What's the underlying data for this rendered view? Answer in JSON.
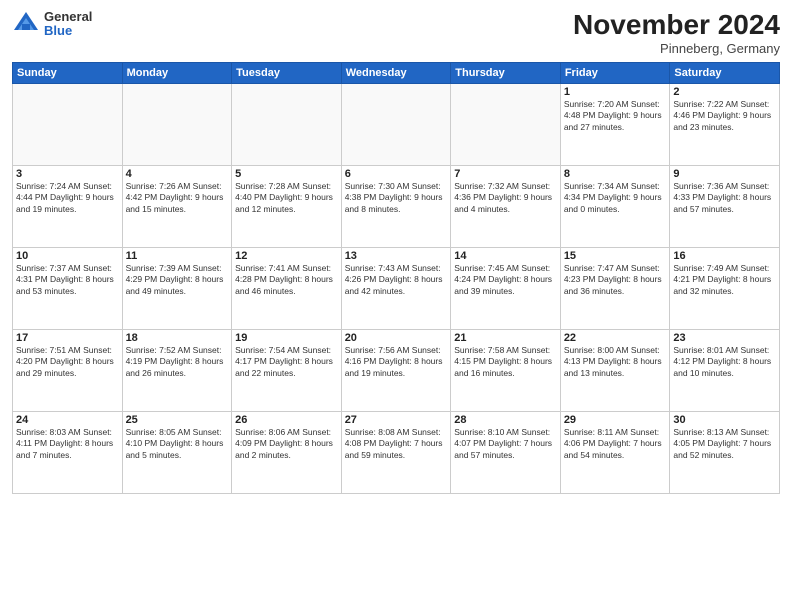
{
  "header": {
    "logo_general": "General",
    "logo_blue": "Blue",
    "month_title": "November 2024",
    "subtitle": "Pinneberg, Germany"
  },
  "days_of_week": [
    "Sunday",
    "Monday",
    "Tuesday",
    "Wednesday",
    "Thursday",
    "Friday",
    "Saturday"
  ],
  "weeks": [
    [
      {
        "day": "",
        "info": ""
      },
      {
        "day": "",
        "info": ""
      },
      {
        "day": "",
        "info": ""
      },
      {
        "day": "",
        "info": ""
      },
      {
        "day": "",
        "info": ""
      },
      {
        "day": "1",
        "info": "Sunrise: 7:20 AM\nSunset: 4:48 PM\nDaylight: 9 hours\nand 27 minutes."
      },
      {
        "day": "2",
        "info": "Sunrise: 7:22 AM\nSunset: 4:46 PM\nDaylight: 9 hours\nand 23 minutes."
      }
    ],
    [
      {
        "day": "3",
        "info": "Sunrise: 7:24 AM\nSunset: 4:44 PM\nDaylight: 9 hours\nand 19 minutes."
      },
      {
        "day": "4",
        "info": "Sunrise: 7:26 AM\nSunset: 4:42 PM\nDaylight: 9 hours\nand 15 minutes."
      },
      {
        "day": "5",
        "info": "Sunrise: 7:28 AM\nSunset: 4:40 PM\nDaylight: 9 hours\nand 12 minutes."
      },
      {
        "day": "6",
        "info": "Sunrise: 7:30 AM\nSunset: 4:38 PM\nDaylight: 9 hours\nand 8 minutes."
      },
      {
        "day": "7",
        "info": "Sunrise: 7:32 AM\nSunset: 4:36 PM\nDaylight: 9 hours\nand 4 minutes."
      },
      {
        "day": "8",
        "info": "Sunrise: 7:34 AM\nSunset: 4:34 PM\nDaylight: 9 hours\nand 0 minutes."
      },
      {
        "day": "9",
        "info": "Sunrise: 7:36 AM\nSunset: 4:33 PM\nDaylight: 8 hours\nand 57 minutes."
      }
    ],
    [
      {
        "day": "10",
        "info": "Sunrise: 7:37 AM\nSunset: 4:31 PM\nDaylight: 8 hours\nand 53 minutes."
      },
      {
        "day": "11",
        "info": "Sunrise: 7:39 AM\nSunset: 4:29 PM\nDaylight: 8 hours\nand 49 minutes."
      },
      {
        "day": "12",
        "info": "Sunrise: 7:41 AM\nSunset: 4:28 PM\nDaylight: 8 hours\nand 46 minutes."
      },
      {
        "day": "13",
        "info": "Sunrise: 7:43 AM\nSunset: 4:26 PM\nDaylight: 8 hours\nand 42 minutes."
      },
      {
        "day": "14",
        "info": "Sunrise: 7:45 AM\nSunset: 4:24 PM\nDaylight: 8 hours\nand 39 minutes."
      },
      {
        "day": "15",
        "info": "Sunrise: 7:47 AM\nSunset: 4:23 PM\nDaylight: 8 hours\nand 36 minutes."
      },
      {
        "day": "16",
        "info": "Sunrise: 7:49 AM\nSunset: 4:21 PM\nDaylight: 8 hours\nand 32 minutes."
      }
    ],
    [
      {
        "day": "17",
        "info": "Sunrise: 7:51 AM\nSunset: 4:20 PM\nDaylight: 8 hours\nand 29 minutes."
      },
      {
        "day": "18",
        "info": "Sunrise: 7:52 AM\nSunset: 4:19 PM\nDaylight: 8 hours\nand 26 minutes."
      },
      {
        "day": "19",
        "info": "Sunrise: 7:54 AM\nSunset: 4:17 PM\nDaylight: 8 hours\nand 22 minutes."
      },
      {
        "day": "20",
        "info": "Sunrise: 7:56 AM\nSunset: 4:16 PM\nDaylight: 8 hours\nand 19 minutes."
      },
      {
        "day": "21",
        "info": "Sunrise: 7:58 AM\nSunset: 4:15 PM\nDaylight: 8 hours\nand 16 minutes."
      },
      {
        "day": "22",
        "info": "Sunrise: 8:00 AM\nSunset: 4:13 PM\nDaylight: 8 hours\nand 13 minutes."
      },
      {
        "day": "23",
        "info": "Sunrise: 8:01 AM\nSunset: 4:12 PM\nDaylight: 8 hours\nand 10 minutes."
      }
    ],
    [
      {
        "day": "24",
        "info": "Sunrise: 8:03 AM\nSunset: 4:11 PM\nDaylight: 8 hours\nand 7 minutes."
      },
      {
        "day": "25",
        "info": "Sunrise: 8:05 AM\nSunset: 4:10 PM\nDaylight: 8 hours\nand 5 minutes."
      },
      {
        "day": "26",
        "info": "Sunrise: 8:06 AM\nSunset: 4:09 PM\nDaylight: 8 hours\nand 2 minutes."
      },
      {
        "day": "27",
        "info": "Sunrise: 8:08 AM\nSunset: 4:08 PM\nDaylight: 7 hours\nand 59 minutes."
      },
      {
        "day": "28",
        "info": "Sunrise: 8:10 AM\nSunset: 4:07 PM\nDaylight: 7 hours\nand 57 minutes."
      },
      {
        "day": "29",
        "info": "Sunrise: 8:11 AM\nSunset: 4:06 PM\nDaylight: 7 hours\nand 54 minutes."
      },
      {
        "day": "30",
        "info": "Sunrise: 8:13 AM\nSunset: 4:05 PM\nDaylight: 7 hours\nand 52 minutes."
      }
    ]
  ]
}
